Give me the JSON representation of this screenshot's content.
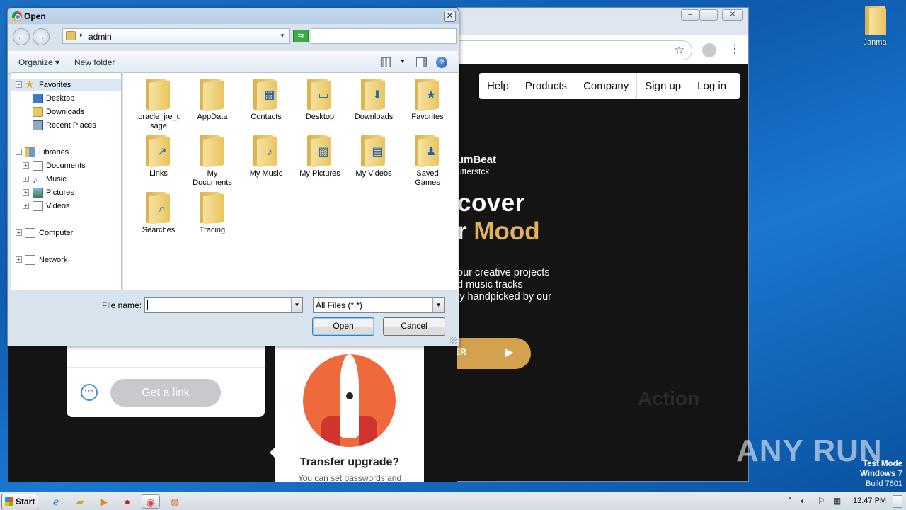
{
  "desktop": {
    "icon_label": "Janma"
  },
  "browser": {
    "nav": [
      "Help",
      "Products",
      "Company",
      "Sign up",
      "Log in"
    ],
    "brand_line1": "umBeat",
    "brand_line2": "utterstck",
    "hero_line1": "cover",
    "hero_line2_prefix": "r ",
    "hero_line2_accent": "Mood",
    "description": "our creative projects\nd music tracks\nly handpicked by our",
    "discover_label": "DISCOVER",
    "faint_text": "Action",
    "colors": {
      "accent": "#e2b15d",
      "button": "#d4a24e",
      "background": "#141414"
    }
  },
  "wetransfer": {
    "get_link_label": "Get a link",
    "upgrade_title": "Transfer upgrade?",
    "upgrade_text": "You can set passwords and"
  },
  "dialog": {
    "title": "Open",
    "breadcrumb": "admin",
    "toolbar": {
      "organize": "Organize",
      "new_folder": "New folder"
    },
    "nav_tree": [
      {
        "label": "Favorites",
        "icon": "star-icon"
      },
      {
        "label": "Desktop",
        "icon": "desktop-icon"
      },
      {
        "label": "Downloads",
        "icon": "folder-icon"
      },
      {
        "label": "Recent Places",
        "icon": "recent-places-icon"
      },
      {
        "label": "Libraries",
        "icon": "libraries-icon"
      },
      {
        "label": "Documents",
        "icon": "documents-icon"
      },
      {
        "label": "Music",
        "icon": "music-icon"
      },
      {
        "label": "Pictures",
        "icon": "pictures-icon"
      },
      {
        "label": "Videos",
        "icon": "videos-icon"
      },
      {
        "label": "Computer",
        "icon": "computer-icon"
      },
      {
        "label": "Network",
        "icon": "network-icon"
      }
    ],
    "files": [
      {
        "label": ".oracle_jre_usage",
        "line1": ".oracle_jre_u",
        "line2": "sage",
        "emblem": ""
      },
      {
        "label": "AppData",
        "line1": "AppData",
        "line2": "",
        "emblem": ""
      },
      {
        "label": "Contacts",
        "line1": "Contacts",
        "line2": "",
        "emblem": "▦"
      },
      {
        "label": "Desktop",
        "line1": "Desktop",
        "line2": "",
        "emblem": "▭"
      },
      {
        "label": "Downloads",
        "line1": "Downloads",
        "line2": "",
        "emblem": "⬇"
      },
      {
        "label": "Favorites",
        "line1": "Favorites",
        "line2": "",
        "emblem": "★"
      },
      {
        "label": "Links",
        "line1": "Links",
        "line2": "",
        "emblem": "↗"
      },
      {
        "label": "My Documents",
        "line1": "My",
        "line2": "Documents",
        "emblem": ""
      },
      {
        "label": "My Music",
        "line1": "My Music",
        "line2": "",
        "emblem": "♪"
      },
      {
        "label": "My Pictures",
        "line1": "My Pictures",
        "line2": "",
        "emblem": "▨"
      },
      {
        "label": "My Videos",
        "line1": "My Videos",
        "line2": "",
        "emblem": "▤"
      },
      {
        "label": "Saved Games",
        "line1": "Saved",
        "line2": "Games",
        "emblem": "♟"
      },
      {
        "label": "Searches",
        "line1": "Searches",
        "line2": "",
        "emblem": "⌕"
      },
      {
        "label": "Tracing",
        "line1": "Tracing",
        "line2": "",
        "emblem": ""
      }
    ],
    "file_name_label": "File name:",
    "file_name_value": "",
    "file_type_value": "All Files (*.*)",
    "open_button": "Open",
    "cancel_button": "Cancel"
  },
  "watermark": {
    "brand": "ANY RUN",
    "test_mode": "Test Mode",
    "os": "Windows 7",
    "build": "Build 7601"
  },
  "taskbar": {
    "start_label": "Start",
    "clock": "12:47 PM"
  }
}
